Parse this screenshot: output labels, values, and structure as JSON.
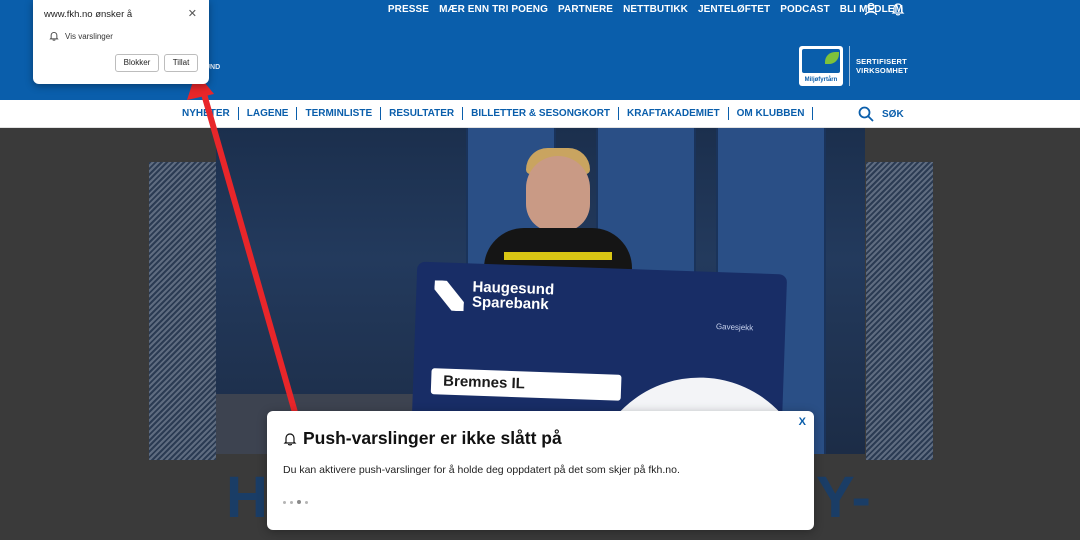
{
  "top_nav": {
    "items": [
      "PRESSE",
      "MÆR ENN TRI POENG",
      "PARTNERE",
      "NETTBUTIKK",
      "JENTELØFTET",
      "PODCAST",
      "BLI MEDLEM"
    ],
    "user_icon": "user-icon",
    "bell_icon": "bell-icon"
  },
  "partial_logo_text": "UND",
  "certification": {
    "logo_text": "Miljøfyrtårn",
    "line1": "SERTIFISERT",
    "line2": "VIRKSOMHET"
  },
  "sub_nav": {
    "items": [
      "NYHETER",
      "LAGENE",
      "TERMINLISTE",
      "RESULTATER",
      "BILLETTER & SESONGKORT",
      "KRAFTAKADEMIET",
      "OM KLUBBEN"
    ],
    "search_label": "SØK"
  },
  "hero": {
    "check_brand_line1": "Haugesund",
    "check_brand_line2": "Sparebank",
    "check_label": "Gavesjekk",
    "check_payee": "Bremnes IL"
  },
  "headline_partial_left": "H",
  "headline_partial_right": "Y-",
  "permission_popup": {
    "title": "www.fkh.no ønsker å",
    "permission_label": "Vis varslinger",
    "block_label": "Blokker",
    "allow_label": "Tillat"
  },
  "push_modal": {
    "close_label": "X",
    "title": "Push-varslinger er ikke slått på",
    "body": "Du kan aktivere push-varslinger for å holde deg oppdatert på det som skjer på fkh.no."
  },
  "colors": {
    "brand_blue": "#0a5eab",
    "arrow_red": "#e8262a",
    "headline_navy": "#1a3d66"
  }
}
